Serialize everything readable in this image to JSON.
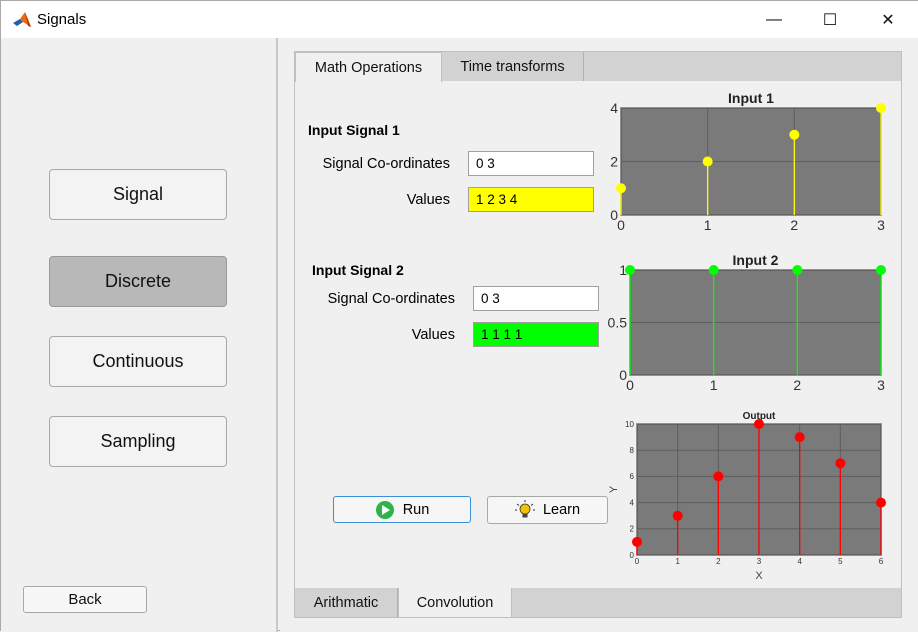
{
  "window": {
    "title": "Signals",
    "minimize": "—",
    "maximize": "☐",
    "close": "✕"
  },
  "sidebar": {
    "buttons": [
      {
        "label": "Signal"
      },
      {
        "label": "Discrete"
      },
      {
        "label": "Continuous"
      },
      {
        "label": "Sampling"
      }
    ],
    "back_label": "Back",
    "active": "Discrete"
  },
  "tabs": {
    "top": [
      "Math Operations",
      "Time transforms"
    ],
    "top_active": "Math Operations",
    "bottom": [
      "Arithmatic",
      "Convolution"
    ],
    "bottom_active": "Convolution"
  },
  "form": {
    "signal1": {
      "heading": "Input Signal 1",
      "coords_label": "Signal Co-ordinates",
      "coords_value": "0 3",
      "values_label": "Values",
      "values_value": "1 2 3 4"
    },
    "signal2": {
      "heading": "Input Signal 2",
      "coords_label": "Signal Co-ordinates",
      "coords_value": "0 3",
      "values_label": "Values",
      "values_value": "1 1 1 1"
    },
    "run_label": "Run",
    "learn_label": "Learn"
  },
  "colors": {
    "plot_bg": "#7a7a7a",
    "signal1": "#ffff00",
    "signal2": "#00ff00",
    "output": "#ff0000",
    "run_border": "#3a8fd6"
  },
  "icons": {
    "app": "matlab-icon",
    "run": "play-icon",
    "learn": "lightbulb-icon"
  },
  "chart_data": [
    {
      "type": "stem",
      "title": "Input 1",
      "x": [
        0,
        1,
        2,
        3
      ],
      "values": [
        1,
        2,
        3,
        4
      ],
      "xlim": [
        0,
        3
      ],
      "ylim": [
        0,
        4
      ],
      "xticks": [
        "0",
        "1",
        "2",
        "3"
      ],
      "yticks": [
        "0",
        "2",
        "4"
      ],
      "grid": true,
      "color": "#ffff00"
    },
    {
      "type": "stem",
      "title": "Input 2",
      "x": [
        0,
        1,
        2,
        3
      ],
      "values": [
        1,
        1,
        1,
        1
      ],
      "xlim": [
        0,
        3
      ],
      "ylim": [
        0,
        1
      ],
      "xticks": [
        "0",
        "1",
        "2",
        "3"
      ],
      "yticks": [
        "0",
        "0.5",
        "1"
      ],
      "grid": true,
      "color": "#00ff00"
    },
    {
      "type": "stem",
      "title": "Output",
      "x": [
        0,
        1,
        2,
        3,
        4,
        5,
        6
      ],
      "values": [
        1,
        3,
        6,
        10,
        9,
        7,
        4
      ],
      "xlim": [
        0,
        6
      ],
      "ylim": [
        0,
        10
      ],
      "xticks": [
        "0",
        "1",
        "2",
        "3",
        "4",
        "5",
        "6"
      ],
      "yticks": [
        "0",
        "2",
        "4",
        "6",
        "8",
        "10"
      ],
      "xlabel": "X",
      "ylabel": "Y",
      "grid": true,
      "color": "#ff0000"
    }
  ]
}
